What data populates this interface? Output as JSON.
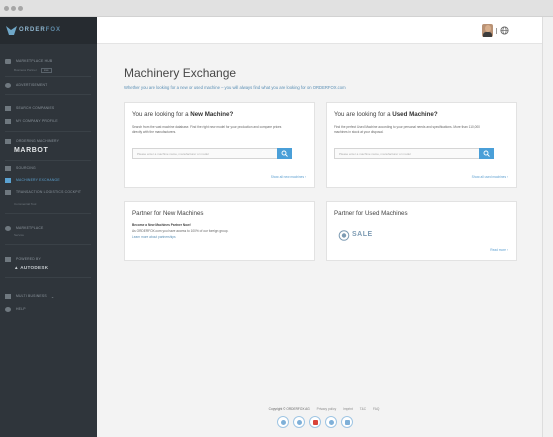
{
  "brand": {
    "name_prefix": "ORDER",
    "name_suffix": "FOX"
  },
  "sidebar": {
    "items": [
      {
        "label": "Marketplace Hub",
        "sub": "Business Partner",
        "badge": "Live"
      },
      {
        "label": "Advertisement"
      },
      {
        "label": "Search Companies"
      },
      {
        "label": "My Company Profile"
      },
      {
        "label": "Ordering Machinery",
        "big": "MARBOT"
      },
      {
        "label": "Sourcing"
      },
      {
        "label": "Machinery Exchange"
      },
      {
        "label": "Transaction Logistics Cockpit",
        "sub": "Commercial Tool"
      },
      {
        "label": "Marketplace",
        "sub": "Service"
      },
      {
        "label": "Powered by",
        "brand": "AUTODESK"
      },
      {
        "label": "Multi Business"
      },
      {
        "label": "Help"
      }
    ]
  },
  "header": {
    "lang": "DE"
  },
  "main": {
    "title": "Machinery Exchange",
    "subtitle": "Whether you are looking for a new or used machine – you will always find what you are looking for on ORDERFOX.com",
    "new_card": {
      "title_pre": "You are looking for a",
      "title_bold": "New Machine?",
      "text": "Search from the vast machine database. Find the right new model for your production and compare prices directly with the manufacturers.",
      "placeholder": "Please enter a machine name, manufacturer or model",
      "link": "Show all new machines ›"
    },
    "used_card": {
      "title_pre": "You are looking for a",
      "title_bold": "Used Machine?",
      "text": "Find the perfect Used Machine according to your personal needs and specifications. More than 110,000 machines in stock at your disposal.",
      "placeholder": "Please enter a machine name, manufacturer or model",
      "link": "Show all used machines ›"
    },
    "partner_new": {
      "title": "Partner for New Machines",
      "bold_line": "Become a New Machines Partner Now!",
      "text": "As ORDERFOX.com you have access to 100% of our foreign group.",
      "link": "Learn more about partnerships"
    },
    "partner_used": {
      "title": "Partner for Used Machines",
      "logo_text": "SALE",
      "link": "Read more ›"
    }
  },
  "footer": {
    "copyright": "Copyright © ORDERFOX AG",
    "links": [
      "Privacy policy",
      "Imprint",
      "T&C",
      "FAQ"
    ],
    "socials": [
      "facebook-icon",
      "twitter-icon",
      "youtube-icon",
      "xing-icon",
      "linkedin-icon"
    ]
  },
  "colors": {
    "sidebar": "#2f353b",
    "accent": "#4a9fd8",
    "youtube": "#d9443a"
  }
}
